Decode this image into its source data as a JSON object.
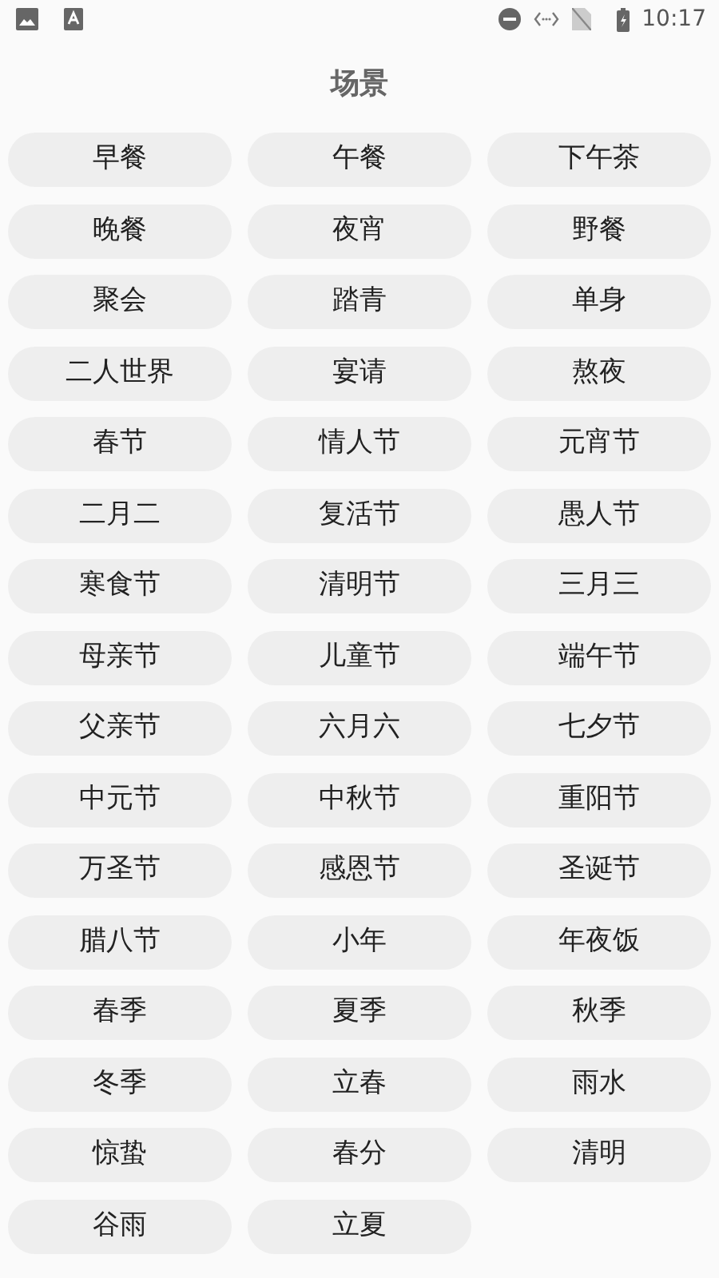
{
  "status_bar": {
    "time": "10:17"
  },
  "title": "场景",
  "scenes": [
    [
      "早餐",
      "午餐",
      "下午茶"
    ],
    [
      "晚餐",
      "夜宵",
      "野餐"
    ],
    [
      "聚会",
      "踏青",
      "单身"
    ],
    [
      "二人世界",
      "宴请",
      "熬夜"
    ],
    [
      "春节",
      "情人节",
      "元宵节"
    ],
    [
      "二月二",
      "复活节",
      "愚人节"
    ],
    [
      "寒食节",
      "清明节",
      "三月三"
    ],
    [
      "母亲节",
      "儿童节",
      "端午节"
    ],
    [
      "父亲节",
      "六月六",
      "七夕节"
    ],
    [
      "中元节",
      "中秋节",
      "重阳节"
    ],
    [
      "万圣节",
      "感恩节",
      "圣诞节"
    ],
    [
      "腊八节",
      "小年",
      "年夜饭"
    ],
    [
      "春季",
      "夏季",
      "秋季"
    ],
    [
      "冬季",
      "立春",
      "雨水"
    ],
    [
      "惊蛰",
      "春分",
      "清明"
    ],
    [
      "谷雨",
      "立夏"
    ]
  ]
}
